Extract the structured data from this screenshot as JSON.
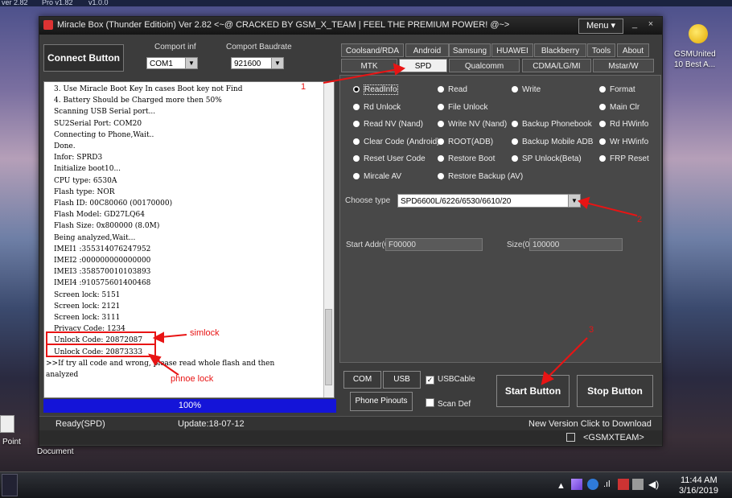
{
  "desktop": {
    "top_left_label": "ver 2.82",
    "top_label_2": "Pro v1.82",
    "top_label_3": "v1.0.0",
    "icon_right_label_1": "GSMUnited",
    "icon_right_label_2": "10 Best A...",
    "icon_left_point": "Point",
    "icon_left_document": "Document"
  },
  "window": {
    "title": "Miracle Box (Thunder Editioin) Ver 2.82 <~@ CRACKED BY GSM_X_TEAM | FEEL THE PREMIUM POWER! @~>",
    "menu_label": "Menu ▾"
  },
  "left": {
    "connect_label": "Connect Button",
    "comport_label": "Comport inf",
    "comport_value": "COM1",
    "baud_label": "Comport Baudrate",
    "baud_value": "921600"
  },
  "log_lines": [
    "3. Use Miracle Boot Key In cases Boot key not Find",
    "4. Battery Should be Charged more then 50%",
    "Scanning USB Serial port...",
    "SU2Serial Port: COM20",
    "Connecting to Phone,Wait..",
    "Done.",
    "Infor: SPRD3",
    "Initialize boot10...",
    "CPU    type: 6530A",
    "Flash  type: NOR",
    "Flash    ID: 00C80060 (00170000)",
    "Flash Model: GD27LQ64",
    "Flash  Size: 0x800000 (8.0M)",
    "Being analyzed,Wait...",
    "IMEI1 :355314076247952",
    "IMEI2 :000000000000000",
    "IMEI3 :358570010103893",
    "IMEI4 :910575601400468",
    "Screen lock: 5151",
    "Screen lock: 2121",
    "Screen lock: 3111",
    "Privacy  Code: 1234",
    "Unlock  Code: 20872087",
    "Unlock  Code: 20873333",
    ">>If try all code and wrong, please read whole flash and then",
    "analyzed"
  ],
  "progress": {
    "label": "100%",
    "value": 1.0
  },
  "tabs_row1": [
    "Coolsand/RDA",
    "Android",
    "Samsung",
    "HUAWEI",
    "Blackberry",
    "Tools",
    "About"
  ],
  "tabs_row2": [
    "MTK",
    "SPD",
    "Qualcomm",
    "CDMA/LG/MI",
    "Mstar/W"
  ],
  "active_tab": "SPD",
  "options": [
    [
      "ReadInfo",
      "Read",
      "Write",
      "Format"
    ],
    [
      "Rd Unlock",
      "File Unlock",
      "",
      "Main Clr"
    ],
    [
      "Read NV (Nand)",
      "Write NV (Nand)",
      "Backup Phonebook",
      "Rd HWinfo"
    ],
    [
      "Clear Code (Android)",
      "ROOT(ADB)",
      "Backup Mobile ADB",
      "Wr HWinfo"
    ],
    [
      "Reset User Code",
      "Restore Boot",
      "SP Unlock(Beta)",
      "FRP Reset"
    ],
    [
      "Mircale AV",
      "Restore Backup (AV)",
      "",
      ""
    ]
  ],
  "selected_option": "ReadInfo",
  "choose_type": {
    "label": "Choose  type",
    "value": "SPD6600L/6226/6530/6610/20"
  },
  "start_addr": {
    "label": "Start Addr(0",
    "value": "F00000"
  },
  "size": {
    "label": "Size(0",
    "value": "100000"
  },
  "bottom": {
    "com_scan": "COM Scan",
    "usb_scan": "USB Scan",
    "usb_cable": "USBCable",
    "usb_cable_checked": true,
    "phone_pinouts": "Phone Pinouts",
    "scan_def": "Scan Def",
    "scan_def_checked": false,
    "start_button": "Start Button",
    "stop_button": "Stop Button"
  },
  "status": {
    "ready": "Ready(SPD)",
    "update": "Update:18-07-12",
    "new_version": "New Version Click to Download",
    "team": "<GSMXTEAM>"
  },
  "annotations": {
    "n1": "1",
    "n2": "2",
    "n3": "3",
    "simlock": "simlock",
    "phone_lock": "phnoe lock"
  },
  "taskbar": {
    "time": "11:44 AM",
    "date": "3/16/2019"
  },
  "colors": {
    "progress": "#1414d8",
    "annotation": "#e81414",
    "window_bg": "#3c3c3c"
  }
}
